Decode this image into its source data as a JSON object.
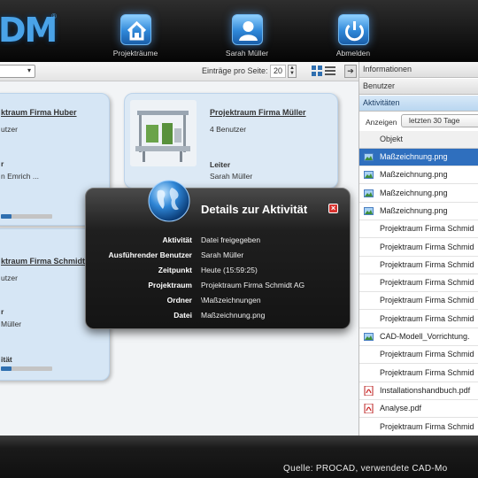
{
  "app": {
    "logo": "DM",
    "logo_mark": "®"
  },
  "nav": {
    "projects_label": "Projekträume",
    "user_label": "Sarah Müller",
    "logout_label": "Abmelden"
  },
  "toolbar": {
    "per_page_label": "Einträge pro Seite:",
    "per_page_value": "20",
    "dropdown_arrow": "▾",
    "nav_arrow": "➔"
  },
  "cards": [
    {
      "title": "ktraum Firma Huber",
      "users": "utzer",
      "leader_fragment": "r",
      "leader_name": "n Emrich ...",
      "activity_label": "",
      "activity_pct": 20
    },
    {
      "title": "Projektraum Firma Müller",
      "users": "4 Benutzer",
      "leader_label": "Leiter",
      "leader_name": "Sarah Müller"
    },
    {
      "title": "ktraum Firma Schmidt",
      "users": "utzer",
      "leader_fragment": "r",
      "leader_name": "Müller",
      "activity_label": "ität",
      "activity_pct": 20
    }
  ],
  "dialog": {
    "title": "Details zur Aktivität",
    "close_symbol": "×",
    "fields": [
      {
        "label": "Aktivität",
        "value": "Datei freigegeben"
      },
      {
        "label": "Ausführender Benutzer",
        "value": "Sarah Müller"
      },
      {
        "label": "Zeitpunkt",
        "value": "Heute (15:59:25)"
      },
      {
        "label": "Projektraum",
        "value": "Projektraum Firma Schmidt AG"
      },
      {
        "label": "Ordner",
        "value": "\\Maßzeichnungen"
      },
      {
        "label": "Datei",
        "value": "Maßzeichnung.png"
      }
    ]
  },
  "panel": {
    "sections": [
      "Informationen",
      "Benutzer",
      "Aktivitäten"
    ],
    "show_label": "Anzeigen",
    "show_value": "letzten 30 Tage",
    "column_header": "Objekt",
    "rows": [
      {
        "label": "Maßzeichnung.png",
        "icon": "image-icon",
        "selected": true
      },
      {
        "label": "Maßzeichnung.png",
        "icon": "image-icon"
      },
      {
        "label": "Maßzeichnung.png",
        "icon": "image-icon"
      },
      {
        "label": "Maßzeichnung.png",
        "icon": "image-icon"
      },
      {
        "label": "Projektraum Firma Schmid",
        "icon": ""
      },
      {
        "label": "Projektraum Firma Schmid",
        "icon": ""
      },
      {
        "label": "Projektraum Firma Schmid",
        "icon": ""
      },
      {
        "label": "Projektraum Firma Schmid",
        "icon": ""
      },
      {
        "label": "Projektraum Firma Schmid",
        "icon": ""
      },
      {
        "label": "Projektraum Firma Schmid",
        "icon": ""
      },
      {
        "label": "CAD-Modell_Vorrichtung.",
        "icon": "image-icon"
      },
      {
        "label": "Projektraum Firma Schmid",
        "icon": ""
      },
      {
        "label": "Projektraum Firma Schmid",
        "icon": ""
      },
      {
        "label": "Installationshandbuch.pdf",
        "icon": "pdf-icon"
      },
      {
        "label": "Analyse.pdf",
        "icon": "pdf-icon"
      },
      {
        "label": "Projektraum Firma Schmid",
        "icon": ""
      }
    ]
  },
  "footer": {
    "caption": "Quelle: PROCAD, verwendete CAD-Mo"
  }
}
